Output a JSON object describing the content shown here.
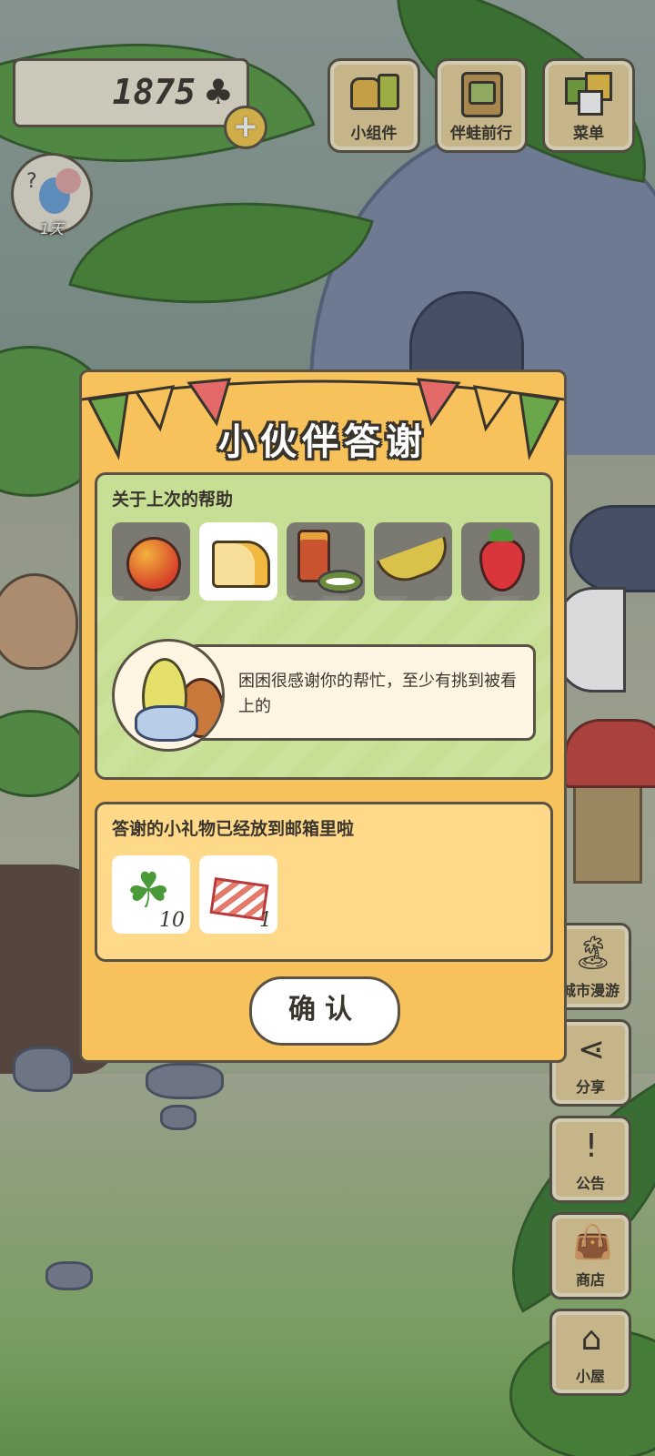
{
  "hud": {
    "clover_count": "1875",
    "clover_symbol": "♣",
    "add_symbol": "+",
    "companion_days": "1天"
  },
  "top_buttons": {
    "widget": "小组件",
    "frog_travel": "伴蛙前行",
    "menu": "菜单"
  },
  "side_buttons": {
    "city_tour": "城市漫游",
    "share": "分享",
    "notice": "公告",
    "shop": "商店",
    "cabin": "小屋"
  },
  "dialog": {
    "title": "小伙伴答谢",
    "help_heading": "关于上次的帮助",
    "foods": [
      "mango",
      "cheese",
      "canned-food",
      "banana",
      "strawberry"
    ],
    "selected_food_index": 1,
    "message": "困困很感谢你的帮忙，至少有挑到被看上的",
    "gift_heading": "答谢的小礼物已经放到邮箱里啦",
    "gifts": [
      {
        "item": "clover",
        "qty": "10"
      },
      {
        "item": "ticket",
        "qty": "1"
      }
    ],
    "confirm": "确认"
  },
  "colors": {
    "modal_bg": "#f7c25c",
    "panel_green": "#c7df95",
    "panel_yellow": "#ffd98a",
    "outline": "#5a5244"
  }
}
